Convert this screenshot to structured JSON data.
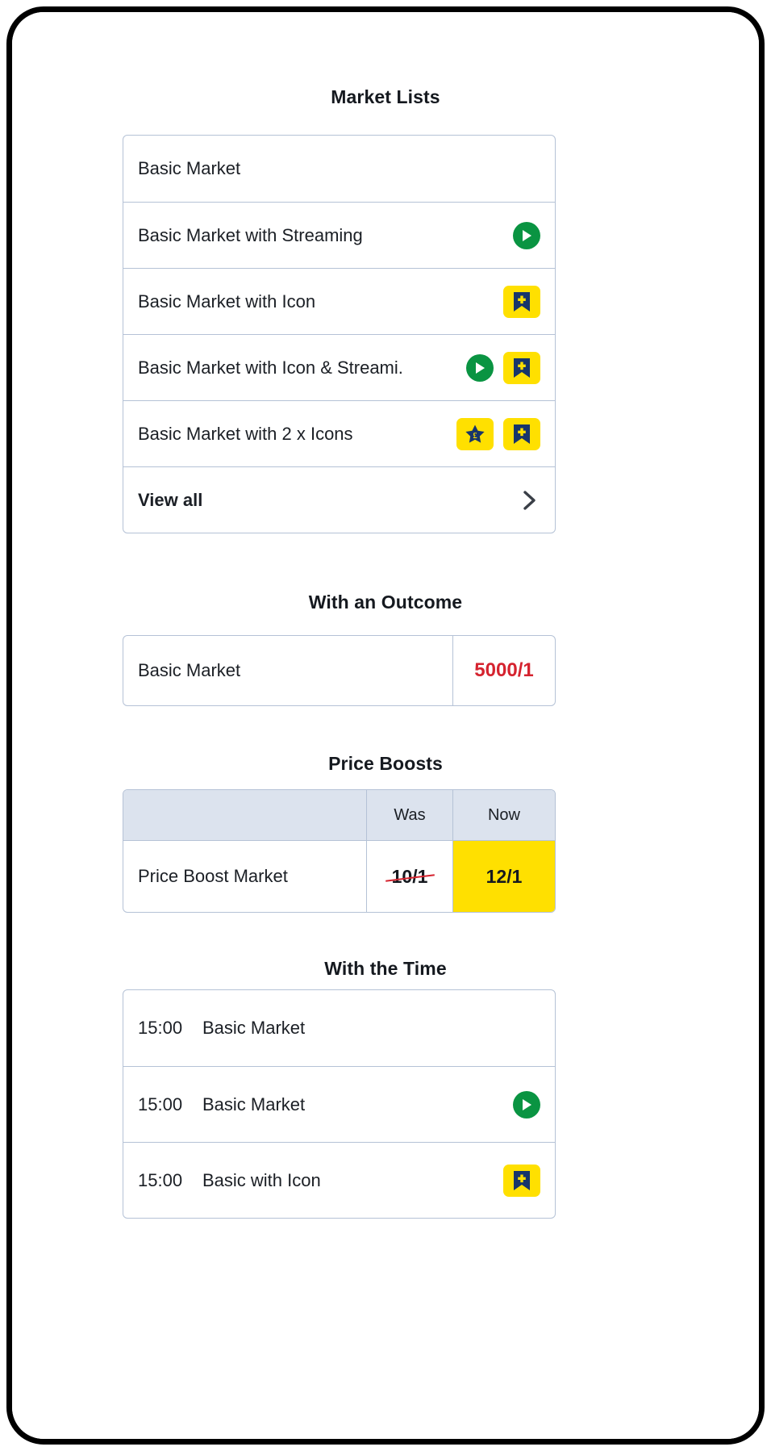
{
  "sections": {
    "market_lists": {
      "title": "Market Lists",
      "rows": [
        {
          "label": "Basic Market",
          "icons": []
        },
        {
          "label": "Basic Market with Streaming",
          "icons": [
            "play-icon"
          ]
        },
        {
          "label": "Basic Market with Icon",
          "icons": [
            "bookmark-plus-icon"
          ]
        },
        {
          "label": "Basic Market with Icon & Streami.",
          "icons": [
            "play-icon",
            "bookmark-plus-icon"
          ]
        },
        {
          "label": "Basic Market with 2 x Icons",
          "icons": [
            "star-pound-icon",
            "bookmark-plus-icon"
          ]
        }
      ],
      "view_all": {
        "label": "View all",
        "chevron": "chevron-right-icon"
      }
    },
    "with_an_outcome": {
      "title": "With an Outcome",
      "name": "Basic Market",
      "price": "5000/1"
    },
    "price_boosts": {
      "title": "Price Boosts",
      "headers": [
        "",
        "Was",
        "Now"
      ],
      "row": {
        "name": "Price Boost Market",
        "was": "10/1",
        "now": "12/1"
      }
    },
    "with_the_time": {
      "title": "With the Time",
      "rows": [
        {
          "time": "15:00",
          "name": "Basic Market",
          "icons": []
        },
        {
          "time": "15:00",
          "name": "Basic Market",
          "icons": [
            "play-icon"
          ]
        },
        {
          "time": "15:00",
          "name": "Basic with Icon",
          "icons": [
            "bookmark-plus-icon"
          ]
        }
      ]
    }
  },
  "colors": {
    "border": "#b5c2d6",
    "text": "#1b1f25",
    "accent_yellow": "#ffe000",
    "accent_navy": "#17356b",
    "accent_green": "#0a9442",
    "accent_red": "#d5232f",
    "table_header_bg": "#dce3ee"
  }
}
